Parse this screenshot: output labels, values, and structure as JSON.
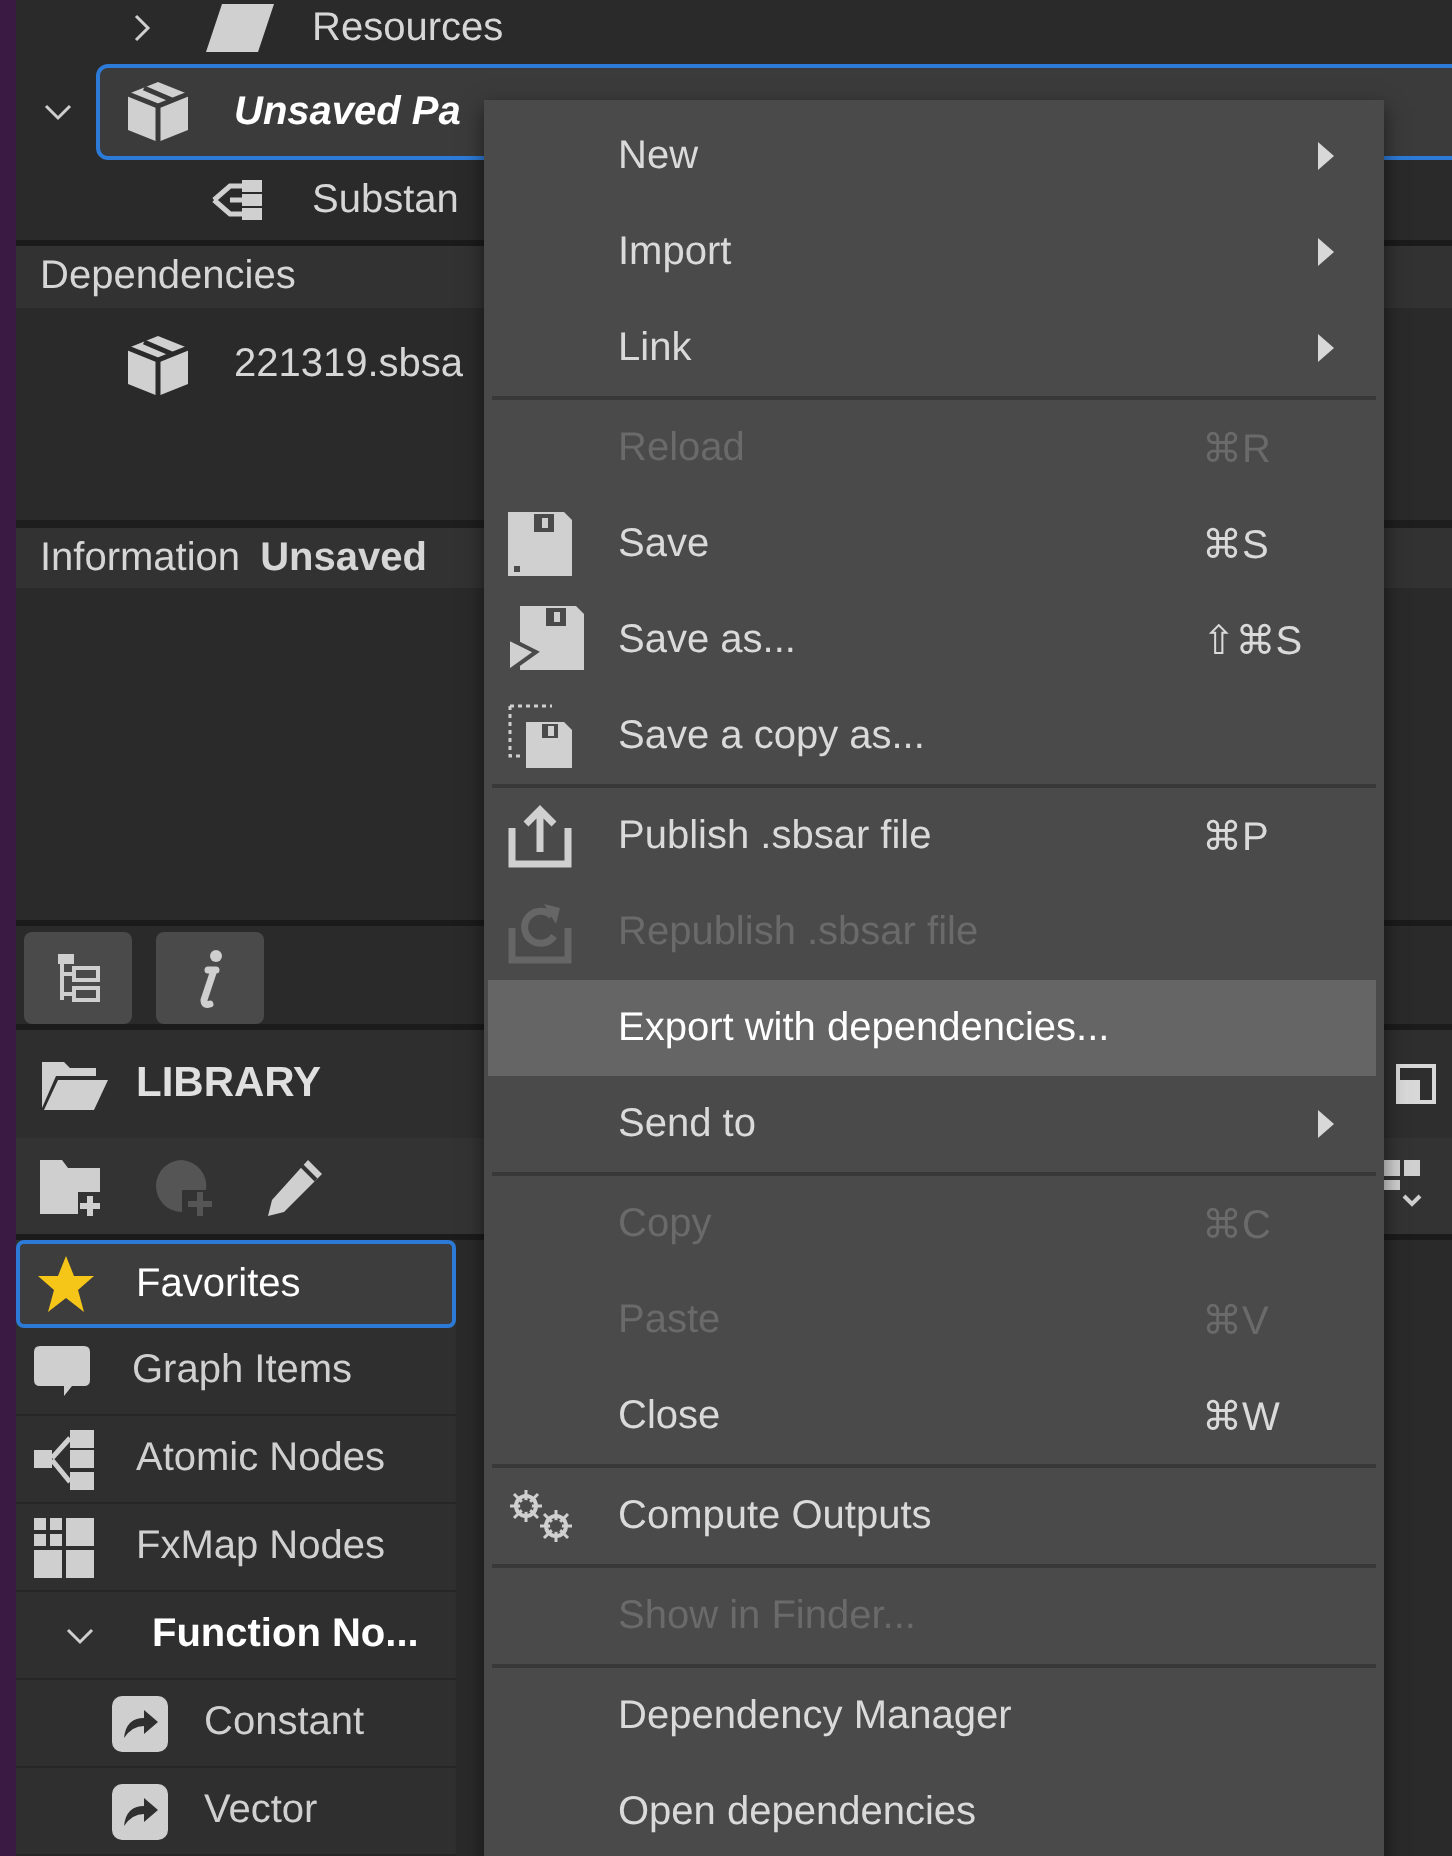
{
  "project_tree": [
    {
      "label": "Resources",
      "expanded": false,
      "selected": false
    },
    {
      "label": "Unsaved Pa",
      "expanded": true,
      "selected": true,
      "children": [
        {
          "label": "Substan",
          "selected": false
        }
      ]
    }
  ],
  "dependencies": {
    "title": "Dependencies",
    "items": [
      "221319.sbsa"
    ]
  },
  "information": {
    "title": "Information",
    "package": "Unsaved"
  },
  "library": {
    "title": "LIBRARY",
    "items": [
      {
        "label": "Favorites",
        "kind": "item",
        "selected": true
      },
      {
        "label": "Graph Items",
        "kind": "item",
        "selected": false
      },
      {
        "label": "Atomic Nodes",
        "kind": "item",
        "selected": false
      },
      {
        "label": "FxMap Nodes",
        "kind": "item",
        "selected": false
      },
      {
        "label": "Function No...",
        "kind": "group",
        "expanded": true,
        "selected": false,
        "children": [
          {
            "label": "Constant",
            "selected": false
          },
          {
            "label": "Vector",
            "selected": false
          }
        ]
      }
    ]
  },
  "context_menu": [
    {
      "kind": "item",
      "label": "New",
      "submenu": true,
      "disabled": false,
      "selected": false
    },
    {
      "kind": "item",
      "label": "Import",
      "submenu": true,
      "disabled": false,
      "selected": false
    },
    {
      "kind": "item",
      "label": "Link",
      "submenu": true,
      "disabled": false,
      "selected": false
    },
    {
      "kind": "separator"
    },
    {
      "kind": "item",
      "label": "Reload",
      "shortcut": "⌘R",
      "submenu": false,
      "disabled": true,
      "selected": false
    },
    {
      "kind": "item",
      "label": "Save",
      "shortcut": "⌘S",
      "submenu": false,
      "disabled": false,
      "selected": false
    },
    {
      "kind": "item",
      "label": "Save as...",
      "shortcut": "⇧⌘S",
      "submenu": false,
      "disabled": false,
      "selected": false
    },
    {
      "kind": "item",
      "label": "Save a copy as...",
      "submenu": false,
      "disabled": false,
      "selected": false
    },
    {
      "kind": "separator"
    },
    {
      "kind": "item",
      "label": "Publish .sbsar file",
      "shortcut": "⌘P",
      "submenu": false,
      "disabled": false,
      "selected": false
    },
    {
      "kind": "item",
      "label": "Republish .sbsar file",
      "submenu": false,
      "disabled": true,
      "selected": false
    },
    {
      "kind": "item",
      "label": "Export with dependencies...",
      "submenu": false,
      "disabled": false,
      "selected": true
    },
    {
      "kind": "item",
      "label": "Send to",
      "submenu": true,
      "disabled": false,
      "selected": false
    },
    {
      "kind": "separator"
    },
    {
      "kind": "item",
      "label": "Copy",
      "shortcut": "⌘C",
      "submenu": false,
      "disabled": true,
      "selected": false
    },
    {
      "kind": "item",
      "label": "Paste",
      "shortcut": "⌘V",
      "submenu": false,
      "disabled": true,
      "selected": false
    },
    {
      "kind": "item",
      "label": "Close",
      "shortcut": "⌘W",
      "submenu": false,
      "disabled": false,
      "selected": false
    },
    {
      "kind": "separator"
    },
    {
      "kind": "item",
      "label": "Compute Outputs",
      "submenu": false,
      "disabled": false,
      "selected": false
    },
    {
      "kind": "separator"
    },
    {
      "kind": "item",
      "label": "Show in Finder...",
      "submenu": false,
      "disabled": true,
      "selected": false
    },
    {
      "kind": "separator"
    },
    {
      "kind": "item",
      "label": "Dependency Manager",
      "submenu": false,
      "disabled": false,
      "selected": false
    },
    {
      "kind": "item",
      "label": "Open dependencies",
      "submenu": false,
      "disabled": false,
      "selected": false
    }
  ]
}
